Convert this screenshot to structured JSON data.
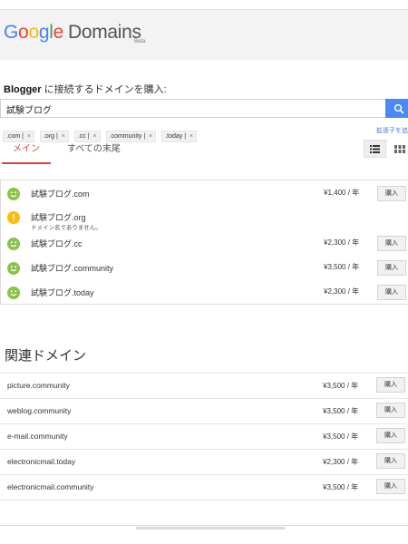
{
  "header": {
    "logo_letters": [
      "G",
      "o",
      "o",
      "g",
      "l",
      "e"
    ],
    "product": "Domains",
    "badge": "Beta"
  },
  "search": {
    "heading_bold": "Blogger",
    "heading_rest": " に接続するドメインを購入:",
    "query": "試験ブログ"
  },
  "tld_filters": [
    ".com",
    ".org",
    ".cc",
    ".community",
    ".today"
  ],
  "tld_separator": " | ",
  "tld_remove": "×",
  "expand_link": "拡張子を追加",
  "tabs": {
    "main": "メイン",
    "all": "すべての末尾"
  },
  "colors": {
    "accent": "#4a8af4",
    "active_tab": "#d14836",
    "available": "#8bc34a",
    "warning": "#fbbc05"
  },
  "results": [
    {
      "name": "試験ブログ.com",
      "status": "available",
      "price": "¥1,400 / 年",
      "buy": "購入"
    },
    {
      "name": "試験ブログ.org",
      "status": "unavailable",
      "note": "ドメイン名でありません。"
    },
    {
      "name": "試験ブログ.cc",
      "status": "available",
      "price": "¥2,300 / 年",
      "buy": "購入"
    },
    {
      "name": "試験ブログ.community",
      "status": "available",
      "price": "¥3,500 / 年",
      "buy": "購入"
    },
    {
      "name": "試験ブログ.today",
      "status": "available",
      "price": "¥2,300 / 年",
      "buy": "購入"
    }
  ],
  "related": {
    "title": "関連ドメイン",
    "items": [
      {
        "name": "picture.community",
        "price": "¥3,500 / 年",
        "buy": "購入"
      },
      {
        "name": "weblog.community",
        "price": "¥3,500 / 年",
        "buy": "購入"
      },
      {
        "name": "e-mail.community",
        "price": "¥3,500 / 年",
        "buy": "購入"
      },
      {
        "name": "electronicmail.today",
        "price": "¥2,300 / 年",
        "buy": "購入"
      },
      {
        "name": "electronicmail.community",
        "price": "¥3,500 / 年",
        "buy": "購入"
      }
    ]
  }
}
